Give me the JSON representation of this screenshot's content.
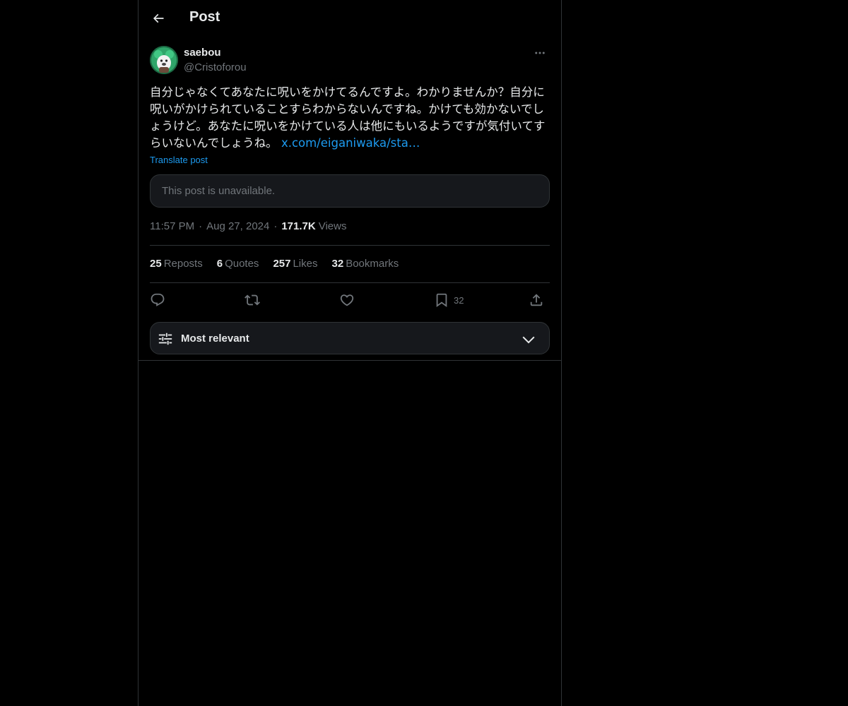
{
  "header": {
    "title": "Post"
  },
  "author": {
    "display_name": "saebou",
    "handle": "@Cristoforou"
  },
  "post": {
    "text": "自分じゃなくてあなたに呪いをかけてるんですよ。わかりませんか？自分に呪いがかけられていることすらわからないんですね。かけても効かないでしょうけど。あなたに呪いをかけている人は他にもいるようですが気付いてすらいないんでしょうね。",
    "link_text": "x.com/eiganiwaka/sta…",
    "translate_label": "Translate post",
    "quoted_unavailable": "This post is unavailable."
  },
  "meta": {
    "time": "11:57 PM",
    "date": "Aug 27, 2024",
    "views_count": "171.7K",
    "views_label": "Views"
  },
  "stats": {
    "reposts_count": "25",
    "reposts_label": "Reposts",
    "quotes_count": "6",
    "quotes_label": "Quotes",
    "likes_count": "257",
    "likes_label": "Likes",
    "bookmarks_count": "32",
    "bookmarks_label": "Bookmarks"
  },
  "actions": {
    "reply_icon": "reply-icon",
    "repost_icon": "repost-icon",
    "like_icon": "heart-icon",
    "bookmark_icon": "bookmark-icon",
    "bookmark_count": "32",
    "share_icon": "share-icon"
  },
  "sort": {
    "label": "Most relevant"
  },
  "colors": {
    "background": "#000000",
    "text": "#e7e9ea",
    "secondary_text": "#71767b",
    "accent": "#1d9bf0",
    "border": "#2f3336",
    "card": "#16181c"
  }
}
